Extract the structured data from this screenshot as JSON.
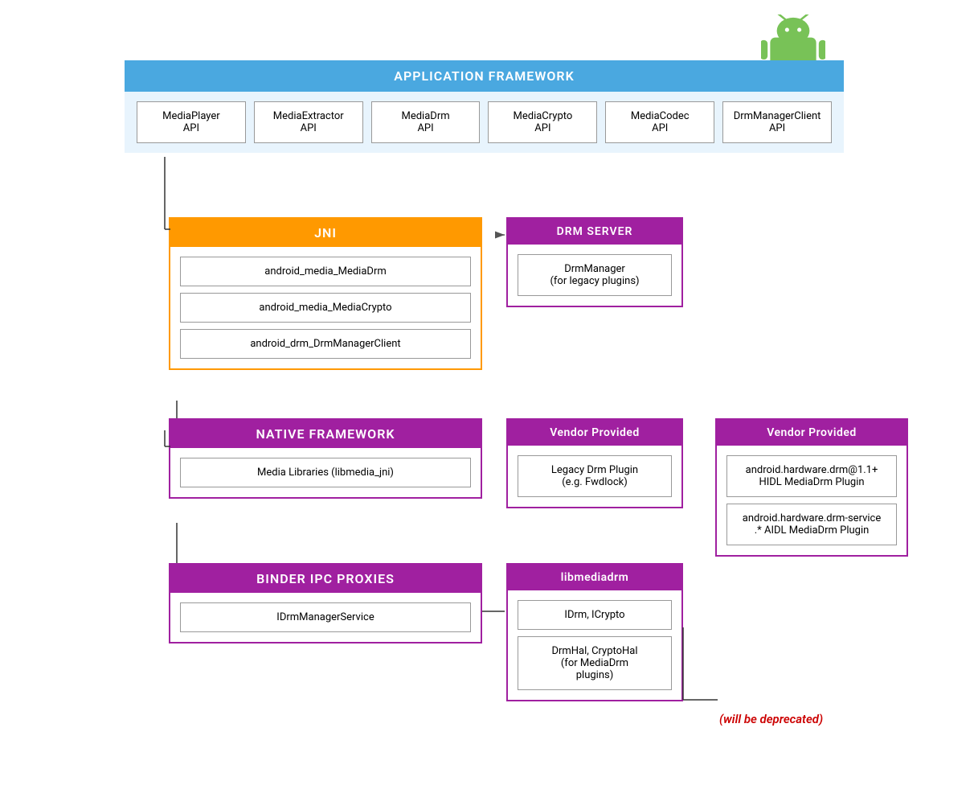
{
  "android_logo": {
    "alt": "Android Logo"
  },
  "app_framework": {
    "header": "APPLICATION FRAMEWORK",
    "apis": [
      {
        "name": "MediaPlayer\nAPI"
      },
      {
        "name": "MediaExtractor\nAPI"
      },
      {
        "name": "MediaDrm\nAPI"
      },
      {
        "name": "MediaCrypto\nAPI"
      },
      {
        "name": "MediaCodec\nAPI"
      },
      {
        "name": "DrmManagerClient\nAPI"
      }
    ]
  },
  "jni": {
    "header": "JNI",
    "items": [
      "android_media_MediaDrm",
      "android_media_MediaCrypto",
      "android_drm_DrmManagerClient"
    ]
  },
  "drm_server": {
    "header": "DRM SERVER",
    "items": [
      "DrmManager\n(for legacy plugins)"
    ]
  },
  "native_framework": {
    "header": "NATIVE FRAMEWORK",
    "items": [
      "Media Libraries (libmedia_jni)"
    ]
  },
  "vendor_left": {
    "header": "Vendor Provided",
    "items": [
      "Legacy Drm Plugin\n(e.g. Fwdlock)"
    ]
  },
  "vendor_right": {
    "header": "Vendor Provided",
    "items": [
      "android.hardware.drm@1.1+\nHIDL MediaDrm Plugin",
      "android.hardware.drm-service\n.* AIDL MediaDrm Plugin"
    ]
  },
  "binder_ipc": {
    "header": "BINDER IPC PROXIES",
    "items": [
      "IDrmManagerService"
    ]
  },
  "libmediadrm": {
    "header": "libmediadrm",
    "items": [
      "IDrm, ICrypto",
      "DrmHal, CryptoHal\n(for MediaDrm\nplugins)"
    ]
  },
  "deprecated": {
    "text": "(will be deprecated)"
  }
}
